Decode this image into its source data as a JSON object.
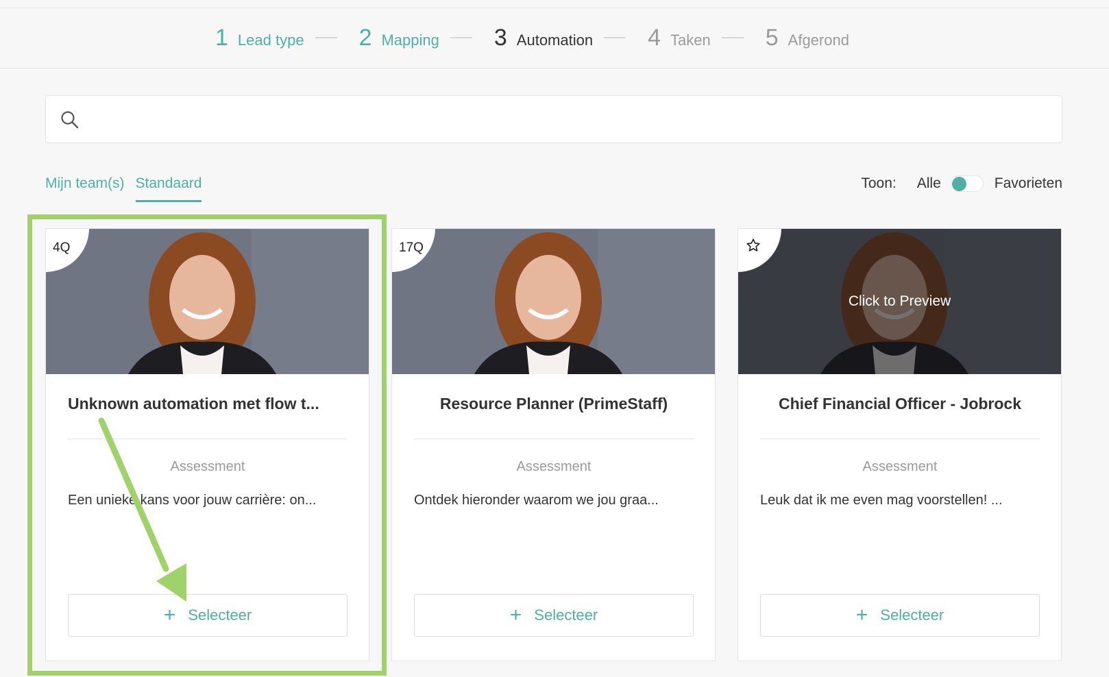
{
  "stepper": {
    "steps": [
      {
        "num": "1",
        "label": "Lead type",
        "state": "done"
      },
      {
        "num": "2",
        "label": "Mapping",
        "state": "done"
      },
      {
        "num": "3",
        "label": "Automation",
        "state": "active"
      },
      {
        "num": "4",
        "label": "Taken",
        "state": "todo"
      },
      {
        "num": "5",
        "label": "Afgerond",
        "state": "todo"
      }
    ]
  },
  "search": {
    "value": "",
    "placeholder": "",
    "icon": "search-icon"
  },
  "tabs": [
    {
      "label": "Mijn team(s)",
      "active": false
    },
    {
      "label": "Standaard",
      "active": true
    }
  ],
  "filter": {
    "label": "Toon:",
    "option_all": "Alle",
    "option_favorites": "Favorieten",
    "toggle_on_all": true
  },
  "cards": [
    {
      "badge": "4Q",
      "title": "Unknown automation met flow t...",
      "type": "Assessment",
      "description": "Een unieke kans voor jouw carrière: on...",
      "button_label": "Selecteer"
    },
    {
      "badge": "17Q",
      "title": "Resource Planner (PrimeStaff)",
      "type": "Assessment",
      "description": "Ontdek hieronder waarom we jou graa...",
      "button_label": "Selecteer"
    },
    {
      "badge": "",
      "badge_icon": "star-icon",
      "overlay_text": "Click to Preview",
      "title": "Chief Financial Officer - Jobrock",
      "type": "Assessment",
      "description": "Leuk dat ik me even mag voorstellen! ...",
      "button_label": "Selecteer"
    }
  ],
  "colors": {
    "accent": "#4db0a4",
    "highlight": "#9fd26b"
  }
}
